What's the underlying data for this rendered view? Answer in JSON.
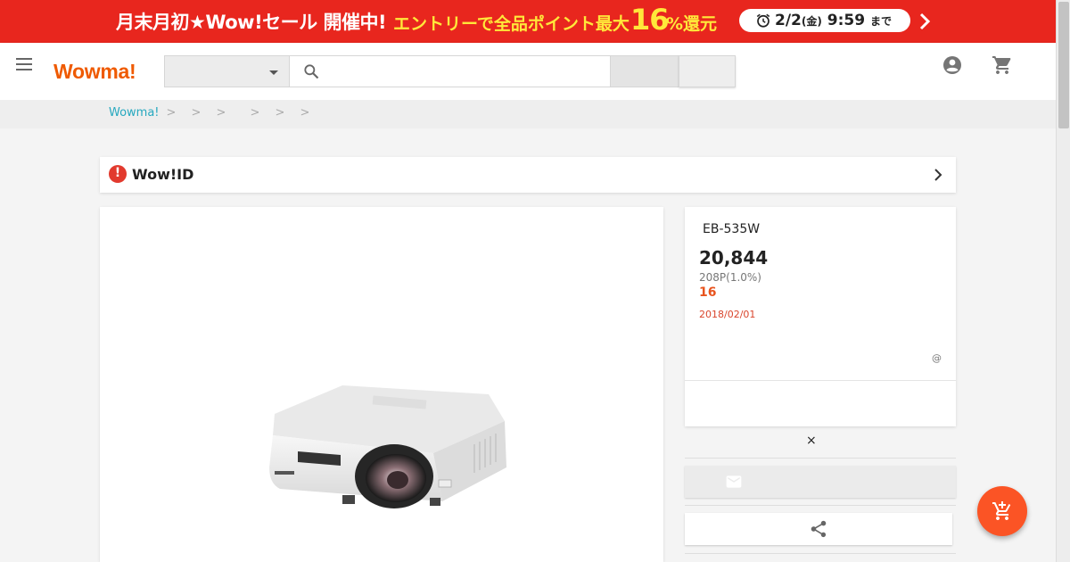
{
  "banner": {
    "headline": "月末月初★Wow!セール 開催中!",
    "entry_text": "エントリーで全品ポイント最大",
    "percent_number": "16",
    "percent_suffix": "%還元",
    "deadline_date": "2/2",
    "deadline_weekday": "(金)",
    "deadline_time": "9:59",
    "deadline_suffix": "まで",
    "icons": [
      "alarm-clock-icon",
      "chevron-right-icon"
    ],
    "colors": {
      "background": "#e8261e",
      "highlight": "#ffe83a"
    }
  },
  "header": {
    "logo": "Wowma!",
    "category_select": {
      "selected": ""
    },
    "search": {
      "value": "",
      "placeholder": ""
    },
    "icons": [
      "menu-icon",
      "search-icon",
      "account-icon",
      "cart-icon"
    ],
    "colors": {
      "logo": "#ef5a00"
    }
  },
  "breadcrumb": {
    "home": "Wowma!",
    "separators": [
      ">",
      ">",
      ">",
      ">",
      ">",
      ">"
    ]
  },
  "wowid": {
    "icon": "alert-icon",
    "icon_glyph": "!",
    "label": "Wow!ID"
  },
  "product": {
    "image_icon": "projector-image",
    "model": "EB-535W",
    "price": "20,844",
    "points": "208P(1.0%)",
    "bonus": "16",
    "date": "2018/02/01",
    "at_symbol": "@"
  },
  "actions": {
    "close_glyph": "×",
    "icons": [
      "mail-icon",
      "share-icon",
      "add-to-cart-icon"
    ],
    "colors": {
      "fab": "#fb5425"
    }
  }
}
